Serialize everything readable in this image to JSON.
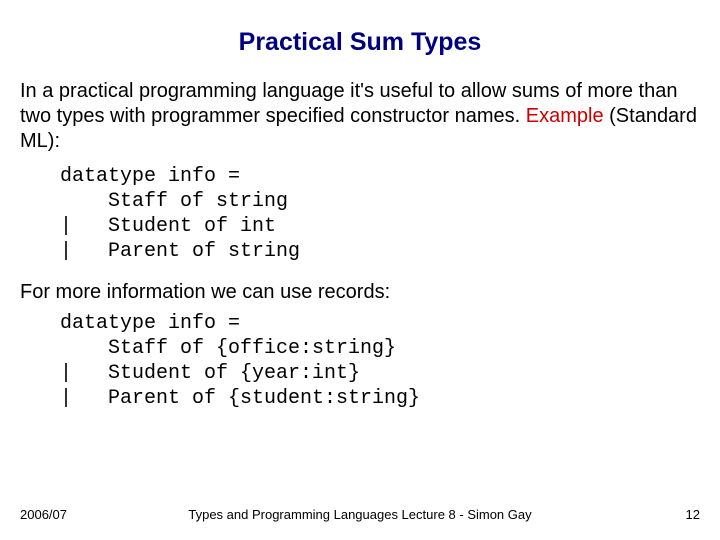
{
  "title": "Practical Sum Types",
  "intro_pre": "In a practical programming language it's useful to allow sums of more than two types with programmer specified constructor names. ",
  "intro_example": "Example",
  "intro_post": " (Standard ML):",
  "code1": "datatype info =\n    Staff of string\n|   Student of int\n|   Parent of string",
  "mid": "For more information we can use records:",
  "code2": "datatype info =\n    Staff of {office:string}\n|   Student of {year:int}\n|   Parent of {student:string}",
  "footer": {
    "left": "2006/07",
    "center": "Types and Programming Languages Lecture 8 - Simon Gay",
    "right": "12"
  }
}
